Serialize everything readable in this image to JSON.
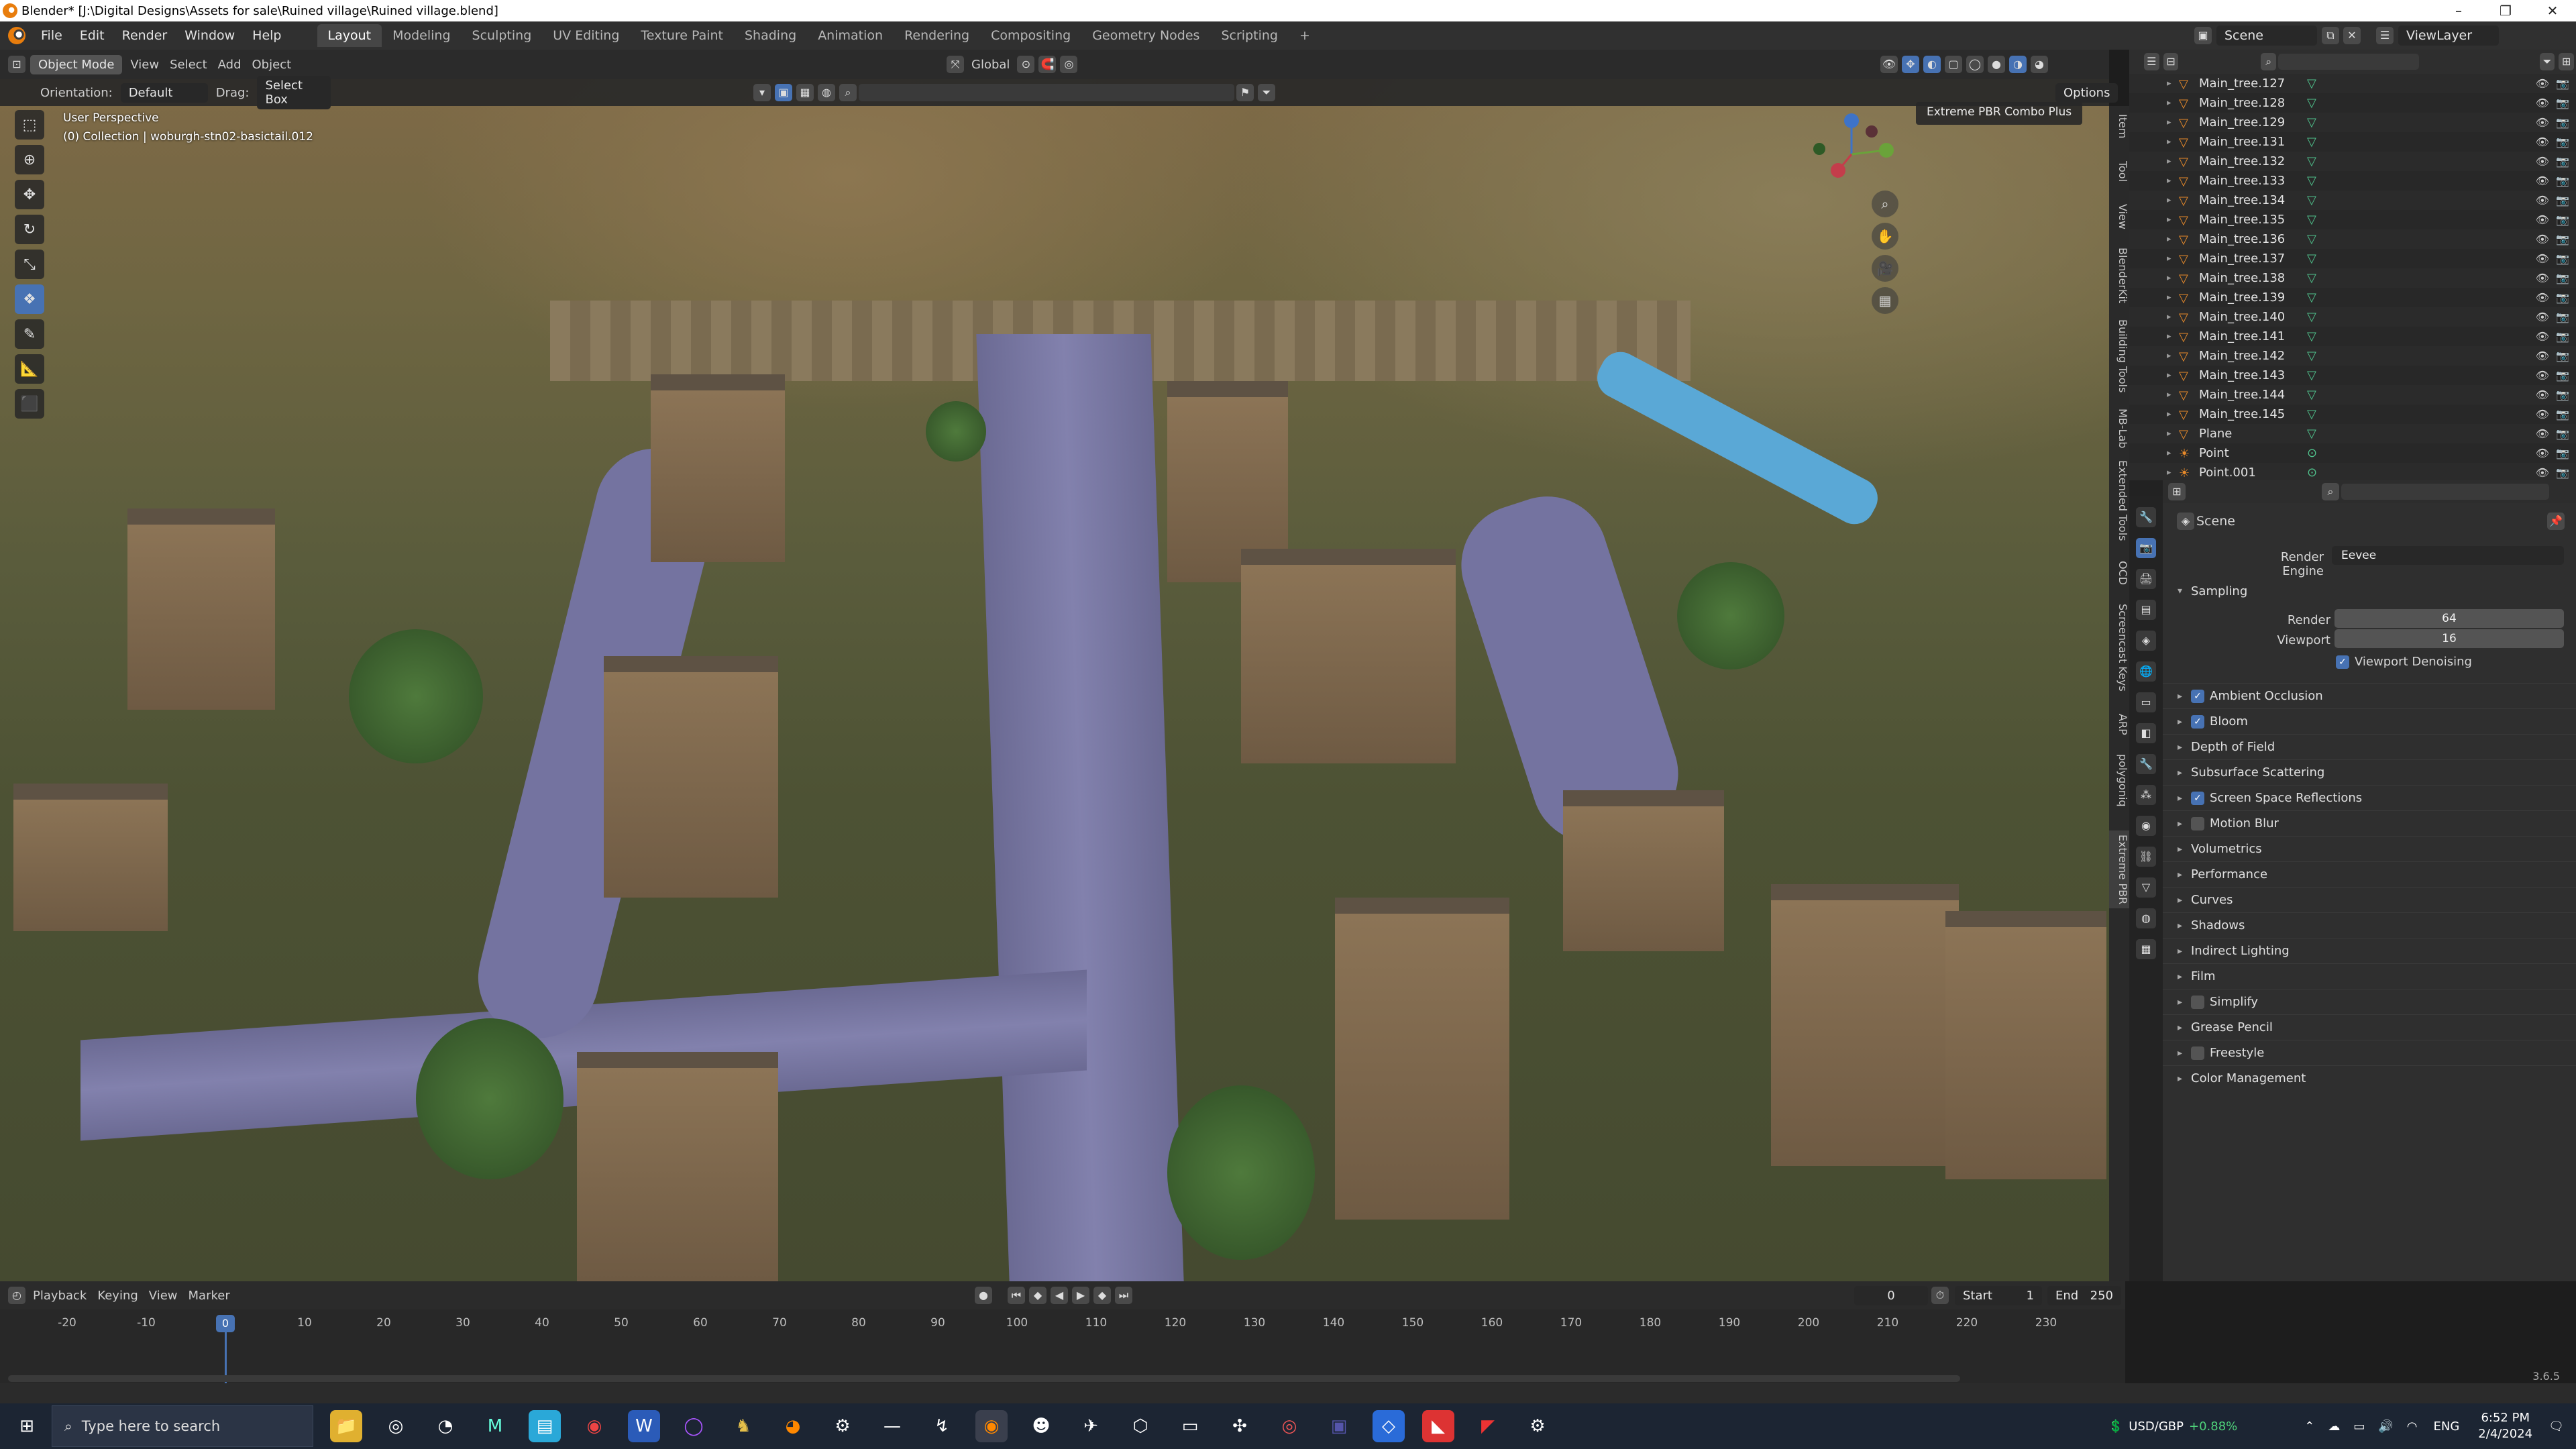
{
  "window": {
    "title": "Blender* [J:\\Digital Designs\\Assets for sale\\Ruined village\\Ruined village.blend]"
  },
  "menu": [
    "File",
    "Edit",
    "Render",
    "Window",
    "Help"
  ],
  "workspaces": [
    "Layout",
    "Modeling",
    "Sculpting",
    "UV Editing",
    "Texture Paint",
    "Shading",
    "Animation",
    "Rendering",
    "Compositing",
    "Geometry Nodes",
    "Scripting",
    "+"
  ],
  "scene_label": "Scene",
  "viewlayer_label": "ViewLayer",
  "viewport_header": {
    "mode": "Object Mode",
    "view": "View",
    "select": "Select",
    "add": "Add",
    "object": "Object",
    "transform": "Global"
  },
  "viewport_header2": {
    "orientation_label": "Orientation:",
    "orientation_value": "Default",
    "drag_label": "Drag:",
    "drag_value": "Select Box",
    "options": "Options"
  },
  "viewport": {
    "perspective": "User Perspective",
    "collection": "(0) Collection | woburgh-stn02-basictail.012",
    "panel_tab": "Extreme PBR Combo Plus"
  },
  "npanel_tabs": [
    "Item",
    "Tool",
    "View",
    "BlenderKit",
    "Building Tools",
    "MB-Lab",
    "Extended Tools",
    "OCD",
    "Screencast Keys",
    "ARP",
    "polygoniq",
    "Extreme PBR"
  ],
  "outliner": {
    "rows": [
      {
        "name": "Main_tree.127",
        "type": "mesh"
      },
      {
        "name": "Main_tree.128",
        "type": "mesh"
      },
      {
        "name": "Main_tree.129",
        "type": "mesh"
      },
      {
        "name": "Main_tree.131",
        "type": "mesh"
      },
      {
        "name": "Main_tree.132",
        "type": "mesh"
      },
      {
        "name": "Main_tree.133",
        "type": "mesh"
      },
      {
        "name": "Main_tree.134",
        "type": "mesh"
      },
      {
        "name": "Main_tree.135",
        "type": "mesh"
      },
      {
        "name": "Main_tree.136",
        "type": "mesh"
      },
      {
        "name": "Main_tree.137",
        "type": "mesh"
      },
      {
        "name": "Main_tree.138",
        "type": "mesh"
      },
      {
        "name": "Main_tree.139",
        "type": "mesh"
      },
      {
        "name": "Main_tree.140",
        "type": "mesh"
      },
      {
        "name": "Main_tree.141",
        "type": "mesh"
      },
      {
        "name": "Main_tree.142",
        "type": "mesh"
      },
      {
        "name": "Main_tree.143",
        "type": "mesh"
      },
      {
        "name": "Main_tree.144",
        "type": "mesh"
      },
      {
        "name": "Main_tree.145",
        "type": "mesh"
      },
      {
        "name": "Plane",
        "type": "mesh"
      },
      {
        "name": "Point",
        "type": "light"
      },
      {
        "name": "Point.001",
        "type": "light"
      }
    ]
  },
  "properties": {
    "scene_name": "Scene",
    "render_engine_label": "Render Engine",
    "render_engine": "Eevee",
    "sampling": {
      "title": "Sampling",
      "render_label": "Render",
      "render_value": "64",
      "viewport_label": "Viewport",
      "viewport_value": "16",
      "denoise_label": "Viewport Denoising"
    },
    "sections": [
      {
        "label": "Ambient Occlusion",
        "checkbox": true
      },
      {
        "label": "Bloom",
        "checkbox": true
      },
      {
        "label": "Depth of Field",
        "checkbox": null
      },
      {
        "label": "Subsurface Scattering",
        "checkbox": null
      },
      {
        "label": "Screen Space Reflections",
        "checkbox": true
      },
      {
        "label": "Motion Blur",
        "checkbox": false
      },
      {
        "label": "Volumetrics",
        "checkbox": null
      },
      {
        "label": "Performance",
        "checkbox": null
      },
      {
        "label": "Curves",
        "checkbox": null
      },
      {
        "label": "Shadows",
        "checkbox": null
      },
      {
        "label": "Indirect Lighting",
        "checkbox": null
      },
      {
        "label": "Film",
        "checkbox": null
      },
      {
        "label": "Simplify",
        "checkbox": false
      },
      {
        "label": "Grease Pencil",
        "checkbox": null
      },
      {
        "label": "Freestyle",
        "checkbox": false
      },
      {
        "label": "Color Management",
        "checkbox": null
      }
    ]
  },
  "timeline": {
    "playback": "Playback",
    "keying": "Keying",
    "view": "View",
    "marker": "Marker",
    "current_frame": "0",
    "start_label": "Start",
    "start": "1",
    "end_label": "End",
    "end": "250",
    "ticks": [
      "-20",
      "-10",
      "0",
      "10",
      "20",
      "30",
      "40",
      "50",
      "60",
      "70",
      "80",
      "90",
      "100",
      "110",
      "120",
      "130",
      "140",
      "150",
      "160",
      "170",
      "180",
      "190",
      "200",
      "210",
      "220",
      "230"
    ],
    "playhead": "0"
  },
  "version": "3.6.5",
  "taskbar": {
    "search_placeholder": "Type here to search",
    "stock": "USD/GBP",
    "stock_change": "+0.88%",
    "lang": "ENG",
    "time": "6:52 PM",
    "date": "2/4/2024"
  }
}
